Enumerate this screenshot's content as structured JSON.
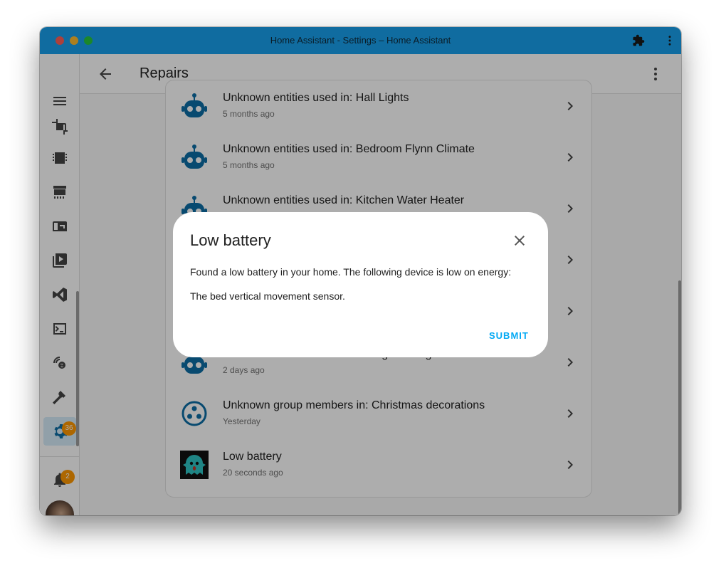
{
  "window": {
    "title": "Home Assistant - Settings – Home Assistant"
  },
  "sidebar": {
    "settings_badge": "36",
    "notifications_badge": "2",
    "items": [
      "crop-icon",
      "memory-icon",
      "hacs-icon",
      "mailbox-icon",
      "media-icon",
      "vscode-icon",
      "terminal-icon",
      "zwave-icon",
      "hammer-icon",
      "settings-icon"
    ]
  },
  "header": {
    "title": "Repairs"
  },
  "repairs": [
    {
      "title": "Unknown entities used in: Hall Lights",
      "subtitle": "5 months ago",
      "icon": "robot-icon"
    },
    {
      "title": "Unknown entities used in: Bedroom Flynn Climate",
      "subtitle": "5 months ago",
      "icon": "robot-icon"
    },
    {
      "title": "Unknown entities used in: Kitchen Water Heater",
      "subtitle": "",
      "icon": "robot-icon"
    },
    {
      "title": "",
      "subtitle": "",
      "icon": ""
    },
    {
      "title": "",
      "subtitle": "",
      "icon": ""
    },
    {
      "title": "Unknown devices used in: Living room lights",
      "subtitle": "2 days ago",
      "icon": "robot-icon"
    },
    {
      "title": "Unknown group members in: Christmas decorations",
      "subtitle": "Yesterday",
      "icon": "group-icon"
    },
    {
      "title": "Low battery",
      "subtitle": "20 seconds ago",
      "icon": "ghost-icon"
    }
  ],
  "dialog": {
    "title": "Low battery",
    "message": "Found a low battery in your home. The following device is low on energy:",
    "device": "The bed vertical movement sensor.",
    "submit_label": "SUBMIT"
  },
  "colors": {
    "titlebar": "#18a0ec",
    "accent": "#03a9f4",
    "badge": "#ff9800",
    "icon": "#0d6ea5"
  }
}
